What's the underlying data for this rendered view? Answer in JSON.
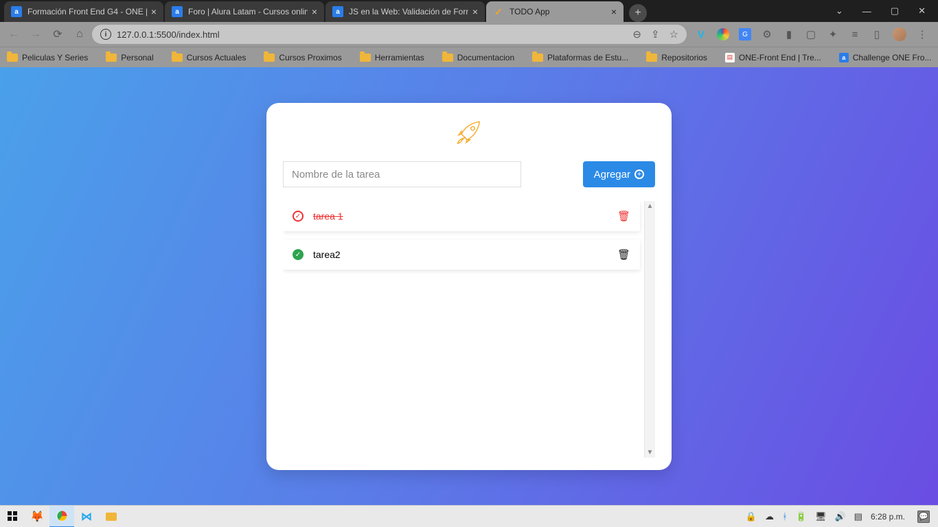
{
  "tabs": [
    {
      "title": "Formación Front End G4 - ONE |",
      "favicon": "a"
    },
    {
      "title": "Foro | Alura Latam - Cursos onlin",
      "favicon": "a"
    },
    {
      "title": "JS en la Web: Validación de Form",
      "favicon": "a"
    },
    {
      "title": "TODO App",
      "favicon": "✓"
    }
  ],
  "active_tab_index": 3,
  "address": "127.0.0.1:5500/index.html",
  "bookmarks": [
    {
      "label": "Peliculas Y Series",
      "kind": "folder"
    },
    {
      "label": "Personal",
      "kind": "folder"
    },
    {
      "label": "Cursos Actuales",
      "kind": "folder"
    },
    {
      "label": "Cursos Proximos",
      "kind": "folder"
    },
    {
      "label": "Herramientas",
      "kind": "folder"
    },
    {
      "label": "Documentacion",
      "kind": "folder"
    },
    {
      "label": "Plataformas de Estu...",
      "kind": "folder"
    },
    {
      "label": "Repositorios",
      "kind": "folder"
    },
    {
      "label": "ONE-Front End | Tre...",
      "kind": "doc"
    },
    {
      "label": "Challenge ONE Fro...",
      "kind": "sq"
    }
  ],
  "app": {
    "input_placeholder": "Nombre de la tarea",
    "add_button": "Agregar"
  },
  "tasks": [
    {
      "name": "tarea 1",
      "done": true
    },
    {
      "name": "tarea2",
      "done": false
    }
  ],
  "taskbar": {
    "time": "6:28 p.m."
  }
}
